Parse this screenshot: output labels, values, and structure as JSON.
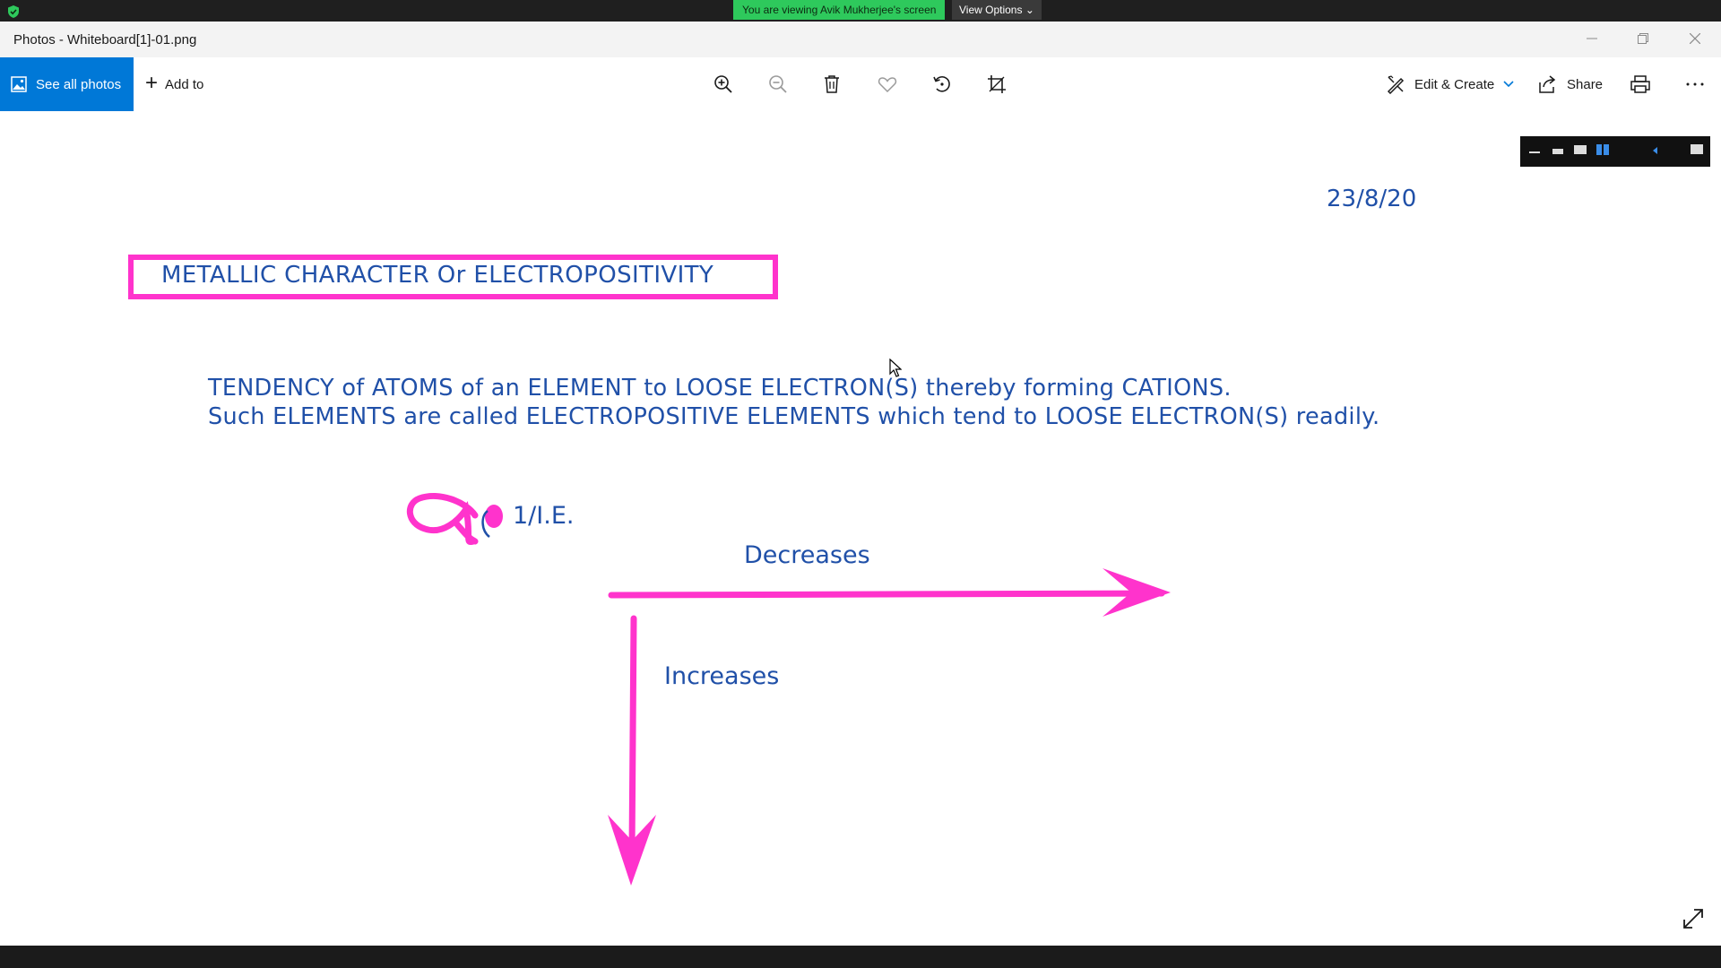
{
  "share_banner": {
    "notice": "You are viewing Avik Mukherjee's screen",
    "view_options": "View Options",
    "shield_icon": "shield-check-icon",
    "accent": "#2ec95c"
  },
  "window": {
    "title": "Photos - Whiteboard[1]-01.png",
    "controls": [
      "minimize-icon",
      "restore-icon",
      "close-icon"
    ]
  },
  "toolbar": {
    "see_all_photos": "See all photos",
    "add_to": "Add to",
    "icons": [
      "zoom-in-icon",
      "zoom-out-icon",
      "delete-icon",
      "favorite-heart-icon",
      "rotate-icon",
      "crop-icon"
    ],
    "edit_create": "Edit & Create",
    "share": "Share",
    "print_icon": "print-icon",
    "more_icon": "more-icon",
    "accent": "#0078d7"
  },
  "whiteboard": {
    "date": "23/8/20",
    "heading": "METALLIC CHARACTER Or ELECTROPOSITIVITY",
    "line1": "TENDENCY of ATOMS of an ELEMENT to LOOSE ELECTRON(S) thereby forming CATIONS.",
    "line2": "Such ELEMENTS are called ELECTROPOSITIVE ELEMENTS which tend to LOOSE ELECTRON(S) readily.",
    "relation": "1/I.E.",
    "horizontal_label": "Decreases",
    "vertical_label": "Increases",
    "ink_color": "#ff33cc",
    "text_color": "#2050a8"
  }
}
